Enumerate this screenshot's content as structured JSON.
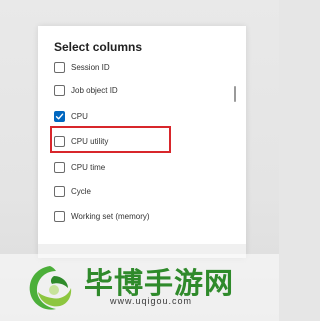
{
  "dialog": {
    "title": "Select columns",
    "options": [
      {
        "label": "Session ID",
        "checked": false
      },
      {
        "label": "Job object ID",
        "checked": false
      },
      {
        "label": "CPU",
        "checked": true
      },
      {
        "label": "CPU utility",
        "checked": false
      },
      {
        "label": "CPU time",
        "checked": false
      },
      {
        "label": "Cycle",
        "checked": false
      },
      {
        "label": "Working set (memory)",
        "checked": false
      }
    ],
    "highlighted_option": "CPU utility"
  },
  "watermark": {
    "brand": "毕博手游网",
    "url": "www.uqigou.com"
  },
  "colors": {
    "checkbox_accent": "#0067c0",
    "highlight": "#d8262b",
    "brand_green": "#2f8a2b"
  },
  "icons": {
    "check": "check-icon",
    "logo": "brand-logo-icon"
  }
}
